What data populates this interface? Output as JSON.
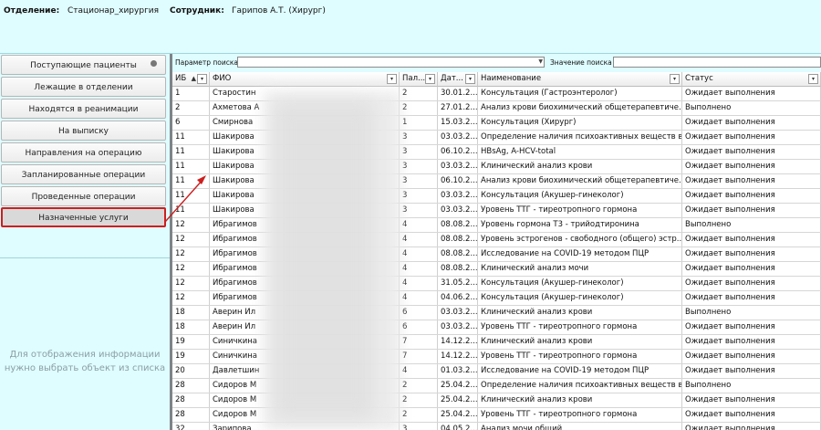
{
  "header": {
    "department_label": "Отделение:",
    "department_value": "Стационар_хирургия",
    "employee_label": "Сотрудник:",
    "employee_value": "Гарипов А.Т. (Хирург)"
  },
  "sidebar": {
    "items": [
      {
        "label": "Поступающие пациенты"
      },
      {
        "label": "Лежащие в отделении"
      },
      {
        "label": "Находятся в реанимации"
      },
      {
        "label": "На выписку"
      },
      {
        "label": "Направления на операцию"
      },
      {
        "label": "Запланированные операции"
      },
      {
        "label": "Проведенные операции"
      },
      {
        "label": "Назначенные услуги"
      }
    ],
    "active_index": 7,
    "hint": "Для отображения информации нужно выбрать объект из списка"
  },
  "search": {
    "param_label": "Параметр поиска",
    "value_label": "Значение поиска",
    "param_value": "",
    "value_value": ""
  },
  "table": {
    "columns": [
      "ИБ",
      "ФИО",
      "Пал...",
      "Дат...",
      "Наименование",
      "Статус"
    ],
    "sorted_column": "ИБ",
    "rows": [
      [
        "1",
        "Старостин",
        "2",
        "30.01.2...",
        "Консультация (Гастроэнтеролог)",
        "Ожидает выполнения"
      ],
      [
        "2",
        "Ахметова А",
        "2",
        "27.01.2...",
        "Анализ крови биохимический общетерапевтиче...",
        "Выполнено"
      ],
      [
        "6",
        "Смирнова",
        "1",
        "15.03.2...",
        "Консультация (Хирург)",
        "Ожидает выполнения"
      ],
      [
        "11",
        "Шакирова",
        "3",
        "03.03.2...",
        "Определение наличия психоактивных веществ в...",
        "Ожидает выполнения"
      ],
      [
        "11",
        "Шакирова",
        "3",
        "06.10.2...",
        "HBsAg, A-HCV-total",
        "Ожидает выполнения"
      ],
      [
        "11",
        "Шакирова",
        "3",
        "03.03.2...",
        "Клинический анализ крови",
        "Ожидает выполнения"
      ],
      [
        "11",
        "Шакирова",
        "3",
        "06.10.2...",
        "Анализ крови биохимический общетерапевтиче...",
        "Ожидает выполнения"
      ],
      [
        "11",
        "Шакирова",
        "3",
        "03.03.2...",
        "Консультация (Акушер-гинеколог)",
        "Ожидает выполнения"
      ],
      [
        "11",
        "Шакирова",
        "3",
        "03.03.2...",
        "Уровень ТТГ - тиреотропного гормона",
        "Ожидает выполнения"
      ],
      [
        "12",
        "Ибрагимов",
        "4",
        "08.08.2...",
        "Уровень гормона Т3 - трийодтиронина",
        "Выполнено"
      ],
      [
        "12",
        "Ибрагимов",
        "4",
        "08.08.2...",
        "Уровень эстрогенов - свободного (общего) эстр...",
        "Ожидает выполнения"
      ],
      [
        "12",
        "Ибрагимов",
        "4",
        "08.08.2...",
        "Исследование на COVID-19 методом ПЦР",
        "Ожидает выполнения"
      ],
      [
        "12",
        "Ибрагимов",
        "4",
        "08.08.2...",
        "Клинический анализ мочи",
        "Ожидает выполнения"
      ],
      [
        "12",
        "Ибрагимов",
        "4",
        "31.05.2...",
        "Консультация (Акушер-гинеколог)",
        "Ожидает выполнения"
      ],
      [
        "12",
        "Ибрагимов",
        "4",
        "04.06.2...",
        "Консультация (Акушер-гинеколог)",
        "Ожидает выполнения"
      ],
      [
        "18",
        "Аверин Ил",
        "6",
        "03.03.2...",
        "Клинический анализ крови",
        "Выполнено"
      ],
      [
        "18",
        "Аверин Ил",
        "6",
        "03.03.2...",
        "Уровень ТТГ - тиреотропного гормона",
        "Ожидает выполнения"
      ],
      [
        "19",
        "Синичкина",
        "7",
        "14.12.2...",
        "Клинический анализ крови",
        "Ожидает выполнения"
      ],
      [
        "19",
        "Синичкина",
        "7",
        "14.12.2...",
        "Уровень ТТГ - тиреотропного гормона",
        "Ожидает выполнения"
      ],
      [
        "20",
        "Давлетшин",
        "4",
        "01.03.2...",
        "Исследование на COVID-19 методом ПЦР",
        "Ожидает выполнения"
      ],
      [
        "28",
        "Сидоров М",
        "2",
        "25.04.2...",
        "Определение наличия психоактивных веществ в...",
        "Выполнено"
      ],
      [
        "28",
        "Сидоров М",
        "2",
        "25.04.2...",
        "Клинический анализ крови",
        "Ожидает выполнения"
      ],
      [
        "28",
        "Сидоров М",
        "2",
        "25.04.2...",
        "Уровень ТТГ - тиреотропного гормона",
        "Ожидает выполнения"
      ],
      [
        "32",
        "Зарипова",
        "3",
        "04.05.2...",
        "Анализ мочи общий",
        "Ожидает выполнения"
      ]
    ]
  },
  "colors": {
    "background": "#dffcff",
    "active_border": "#cc1f1f",
    "annotation_arrow": "#cc1f1f"
  }
}
